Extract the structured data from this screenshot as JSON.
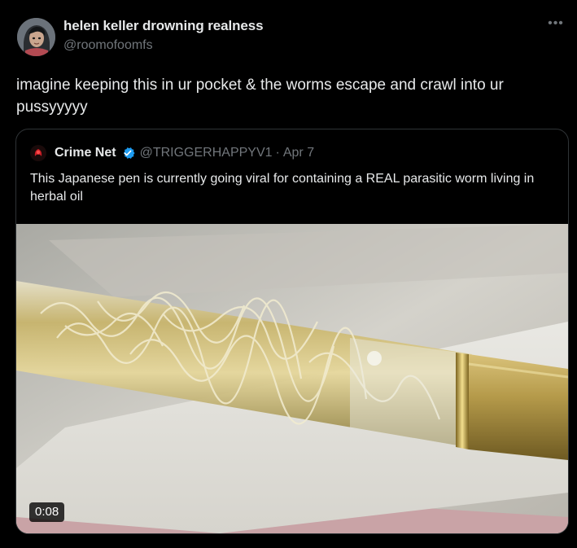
{
  "author": {
    "display_name": "helen keller drowning realness",
    "handle": "@roomofoomfs"
  },
  "more_icon": "more-horizontal-icon",
  "tweet_text": "imagine keeping this in ur pocket & the worms escape and crawl into ur pussyyyyy",
  "quoted": {
    "name": "Crime Net",
    "verified": true,
    "verified_color": "#1d9bf0",
    "handle": "@TRIGGERHAPPYV1",
    "separator": "·",
    "date": "Apr 7",
    "text": "This Japanese pen is currently going viral for containing a REAL parasitic worm living in herbal oil",
    "media": {
      "type": "video",
      "duration": "0:08"
    }
  },
  "colors": {
    "background": "#000000",
    "text_primary": "#e7e9ea",
    "text_secondary": "#71767b",
    "border": "#2f3336"
  }
}
